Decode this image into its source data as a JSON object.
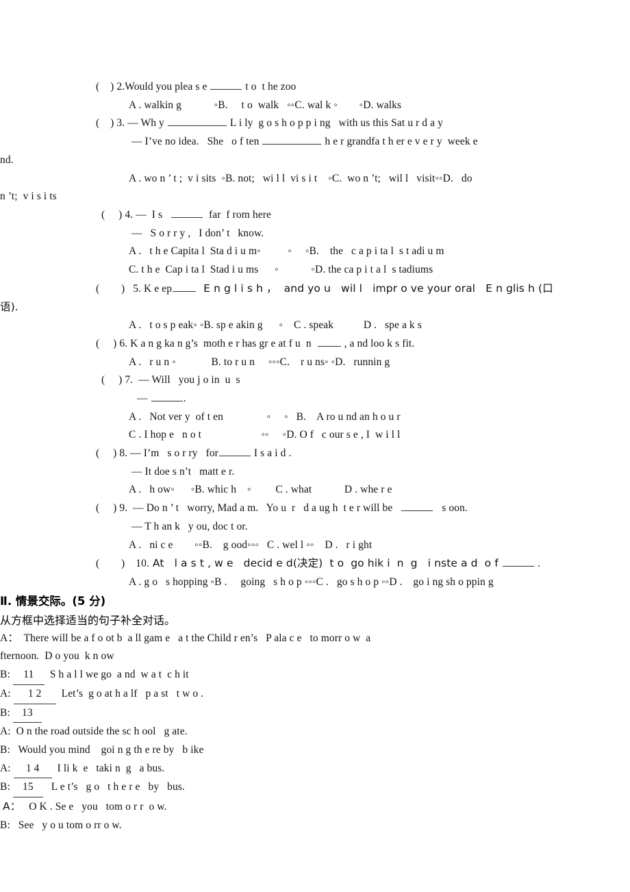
{
  "document": {
    "type": "english-exam-worksheet",
    "background": "#ffffff",
    "text_color": "#111111"
  },
  "questions": [
    {
      "id": "q2",
      "marker": "(    ) 2.",
      "stem_before": "Would you plea s e ",
      "stem_after": " t o  t he zoo",
      "options_line": "A . walkin g            ◦B.     t o  walk   ◦◦C. wal k ◦        ◦D. walks"
    },
    {
      "id": "q3",
      "marker": "(    ) 3.",
      "stem_before": " — Wh y ",
      "stem_after": " L i ly  g o s h o p p i ng   with us this Sat u r d a y",
      "line2_before": " — I’ve no idea.   She   o f ten ",
      "line2_after": " h e r grandfa t h er e v e r y  week e",
      "line3": "nd.",
      "options_line": "A . wo n ’ t ;  v i sits  ◦B. not;   wi l l  vi s i t    ◦C.  wo n ’t;   wil l   visit◦◦D.   do",
      "options_line2": "n ’t;  v i s i ts"
    },
    {
      "id": "q4",
      "marker": "(     ) 4.",
      "stem_before": " —  I s   ",
      "stem_after": "  far  f rom here",
      "line2": " —   S o r r y ,   I don’ t   know.",
      "options_line_1": "A .   t h e Capita l  Sta d i u m◦          ◦     ◦B.    the   c a p i ta l  s t adi u m",
      "options_line_2": "C. t h e  Cap i ta l  Stad i u ms      ◦            ◦D. the ca p i t a l  s tadiums"
    },
    {
      "id": "q5",
      "marker": "(        )   5.",
      "stem_before": " K e ep",
      "stem_after": "  E n g l i s h ，  and yo u   wil l   impr o ve your oral   E n glis h (口",
      "line2": "语).",
      "options_line": "A .   t o s p eak◦ ◦B. sp e akin g      ◦    C . speak           D .   spe a k s"
    },
    {
      "id": "q6",
      "marker": "(     ) 6.",
      "stem_before": " K a n g ka n g’s  moth e r has gr e at f u  n  ",
      "stem_after": " , a nd loo k s fit.",
      "options_line": "A .   r u n ◦             B. to r u n     ◦◦◦C.    r u ns◦ ◦D.   runnin g"
    },
    {
      "id": "q7",
      "marker": "(     ) 7.",
      "stem": "  — Will   you j o in  u  s",
      "line2_prefix": " — ",
      "line2_suffix": ".",
      "options_line_1": "A .   Not ver y  of t en                ◦     ◦   B.    A ro u nd an h o u r",
      "options_line_2": "C . I hop e   n o t                      ◦◦     ◦D. O f   c our s e , I  w i l l"
    },
    {
      "id": "q8",
      "marker": "(     ) 8.",
      "stem_before": " — I’m   s o r ry   for",
      "stem_after": " I s a i d .",
      "line2": " — It doe s n’t   matt e r.",
      "options_line": "A .   h ow◦      ◦B. whic h    ◦         C . what            D . whe r e"
    },
    {
      "id": "q9",
      "marker": "(     ) 9.",
      "stem_before": "  — Do n ’ t   worry, Mad a m.   Yo u  r   d a ug h  t e r will be   ",
      "stem_after": "   s oon.",
      "line2": " — T h an k   y ou, doc t or.",
      "options_line": "A .   ni c e        ◦◦B.    g ood◦◦◦   C . wel l ◦◦    D .   r i ght"
    },
    {
      "id": "q10",
      "marker": "(        )    10.",
      "stem_before": " At   l a s t , w e   decid e d(决定)  t o  go hik i  n  g   i nste a d  o f ",
      "stem_after": " .",
      "options_line": "A . g o   s hopping ◦B .     going   s h o p ◦◦◦C .   go s h o p ◦◦D .    go i ng sh o ppin g"
    }
  ],
  "section2": {
    "heading": "Ⅱ. 情景交际。(5 分)",
    "instruction": "从方框中选择适当的句子补全对话。",
    "dialogue": [
      {
        "speaker": "A：",
        "text": "  There will be a f o ot b  a ll gam e   a t the Child r en’s   P ala c e   to morr o w  a",
        "wrap": "fternoon.  D o you  k n ow",
        "blank": null
      },
      {
        "speaker": "B:",
        "blank": "11",
        "text": "  S h a l l we go  a nd  w a t  c h it",
        "wrap": null
      },
      {
        "speaker": "A:",
        "blank": "1 2",
        "text": "  Let’s  g o at h a lf   p a st   t w o .",
        "wrap": null
      },
      {
        "speaker": "B:",
        "blank": "13",
        "text": "",
        "wrap": null
      },
      {
        "speaker": "A:",
        "blank": null,
        "text": "  O n the road outside the sc h ool   g ate.",
        "wrap": null
      },
      {
        "speaker": "B:",
        "blank": null,
        "text": "   Would you mind    goi n g th e re by   b ike",
        "wrap": null
      },
      {
        "speaker": "A:",
        "blank": "1 4",
        "text": "  I li k  e   taki n  g   a bus.",
        "wrap": null
      },
      {
        "speaker": "B:",
        "blank": "15",
        "text": "   L e t’s   g o   t h e r e   by   bus.",
        "wrap": null
      },
      {
        "speaker": "A：",
        "blank": null,
        "text": "   O K . Se e   you   tom o r r  o w.",
        "wrap": null
      },
      {
        "speaker": "B:",
        "blank": null,
        "text": "   See   y o u tom o rr o w.",
        "wrap": null
      }
    ]
  }
}
